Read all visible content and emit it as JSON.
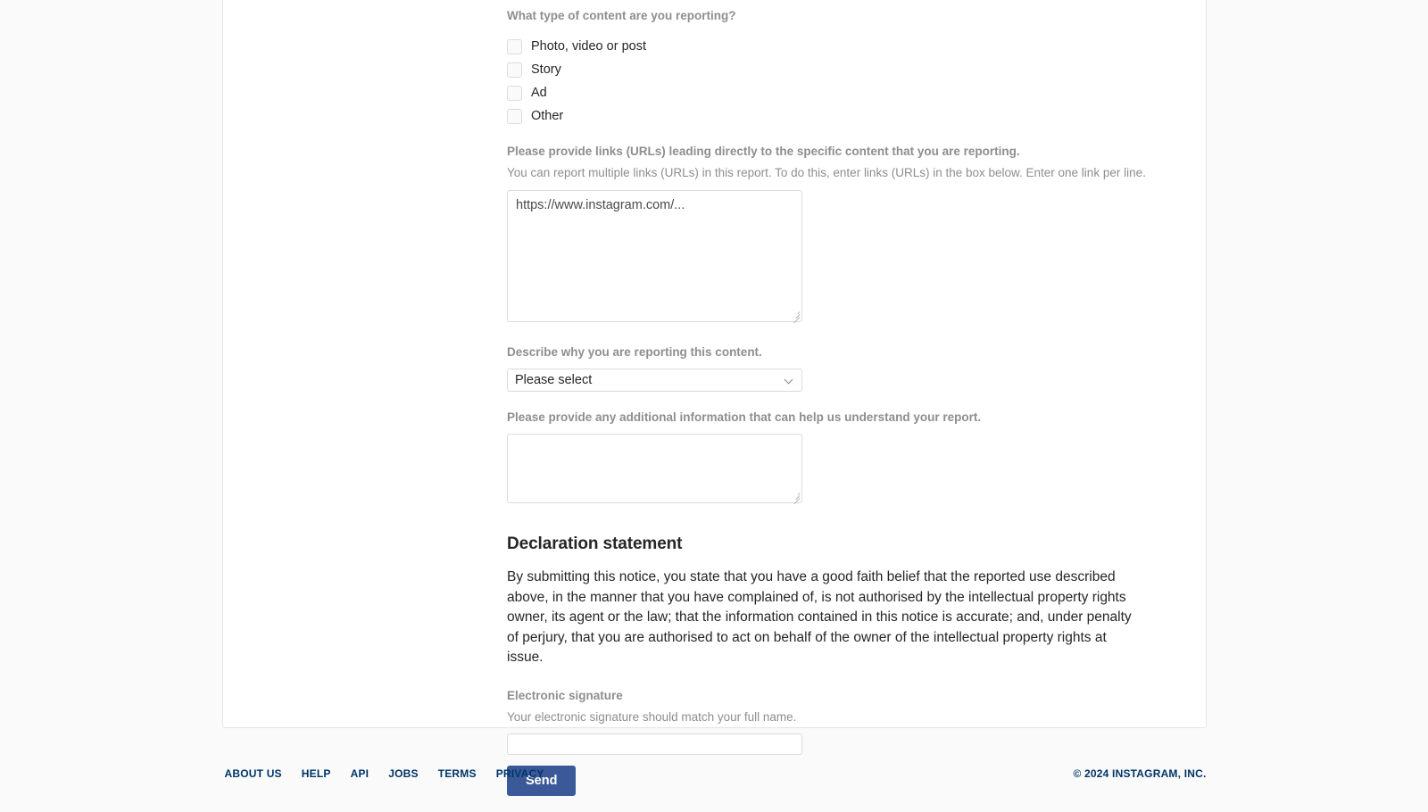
{
  "form": {
    "content_type": {
      "label": "What type of content are you reporting?",
      "options": [
        {
          "label": "Photo, video or post",
          "checked": false
        },
        {
          "label": "Story",
          "checked": false
        },
        {
          "label": "Ad",
          "checked": false
        },
        {
          "label": "Other",
          "checked": false
        }
      ]
    },
    "links": {
      "label": "Please provide links (URLs) leading directly to the specific content that you are reporting.",
      "help": "You can report multiple links (URLs) in this report. To do this, enter links (URLs) in the box below. Enter one link per line.",
      "value": "",
      "placeholder": "https://www.instagram.com/..."
    },
    "reason": {
      "label": "Describe why you are reporting this content.",
      "selected": "Please select"
    },
    "additional_info": {
      "label": "Please provide any additional information that can help us understand your report.",
      "value": "",
      "placeholder": ""
    },
    "declaration": {
      "title": "Declaration statement",
      "body": "By submitting this notice, you state that you have a good faith belief that the reported use described above, in the manner that you have complained of, is not authorised by the intellectual property rights owner, its agent or the law; that the information contained in this notice is accurate; and, under penalty of perjury, that you are authorised to act on behalf of the owner of the intellectual property rights at issue."
    },
    "signature": {
      "label": "Electronic signature",
      "help": "Your electronic signature should match your full name.",
      "value": "",
      "placeholder": ""
    },
    "submit_label": "Send"
  },
  "footer": {
    "links": [
      {
        "label": "ABOUT US"
      },
      {
        "label": "HELP"
      },
      {
        "label": "API"
      },
      {
        "label": "JOBS"
      },
      {
        "label": "TERMS"
      },
      {
        "label": "PRIVACY"
      }
    ],
    "copyright": "© 2024 INSTAGRAM, INC."
  },
  "colors": {
    "page_background": "#fafafa",
    "card_background": "#ffffff",
    "label_gray": "#8e8e8e",
    "text_dark": "#262626",
    "accent_blue": "#3b5998",
    "footer_navy": "#003569"
  }
}
